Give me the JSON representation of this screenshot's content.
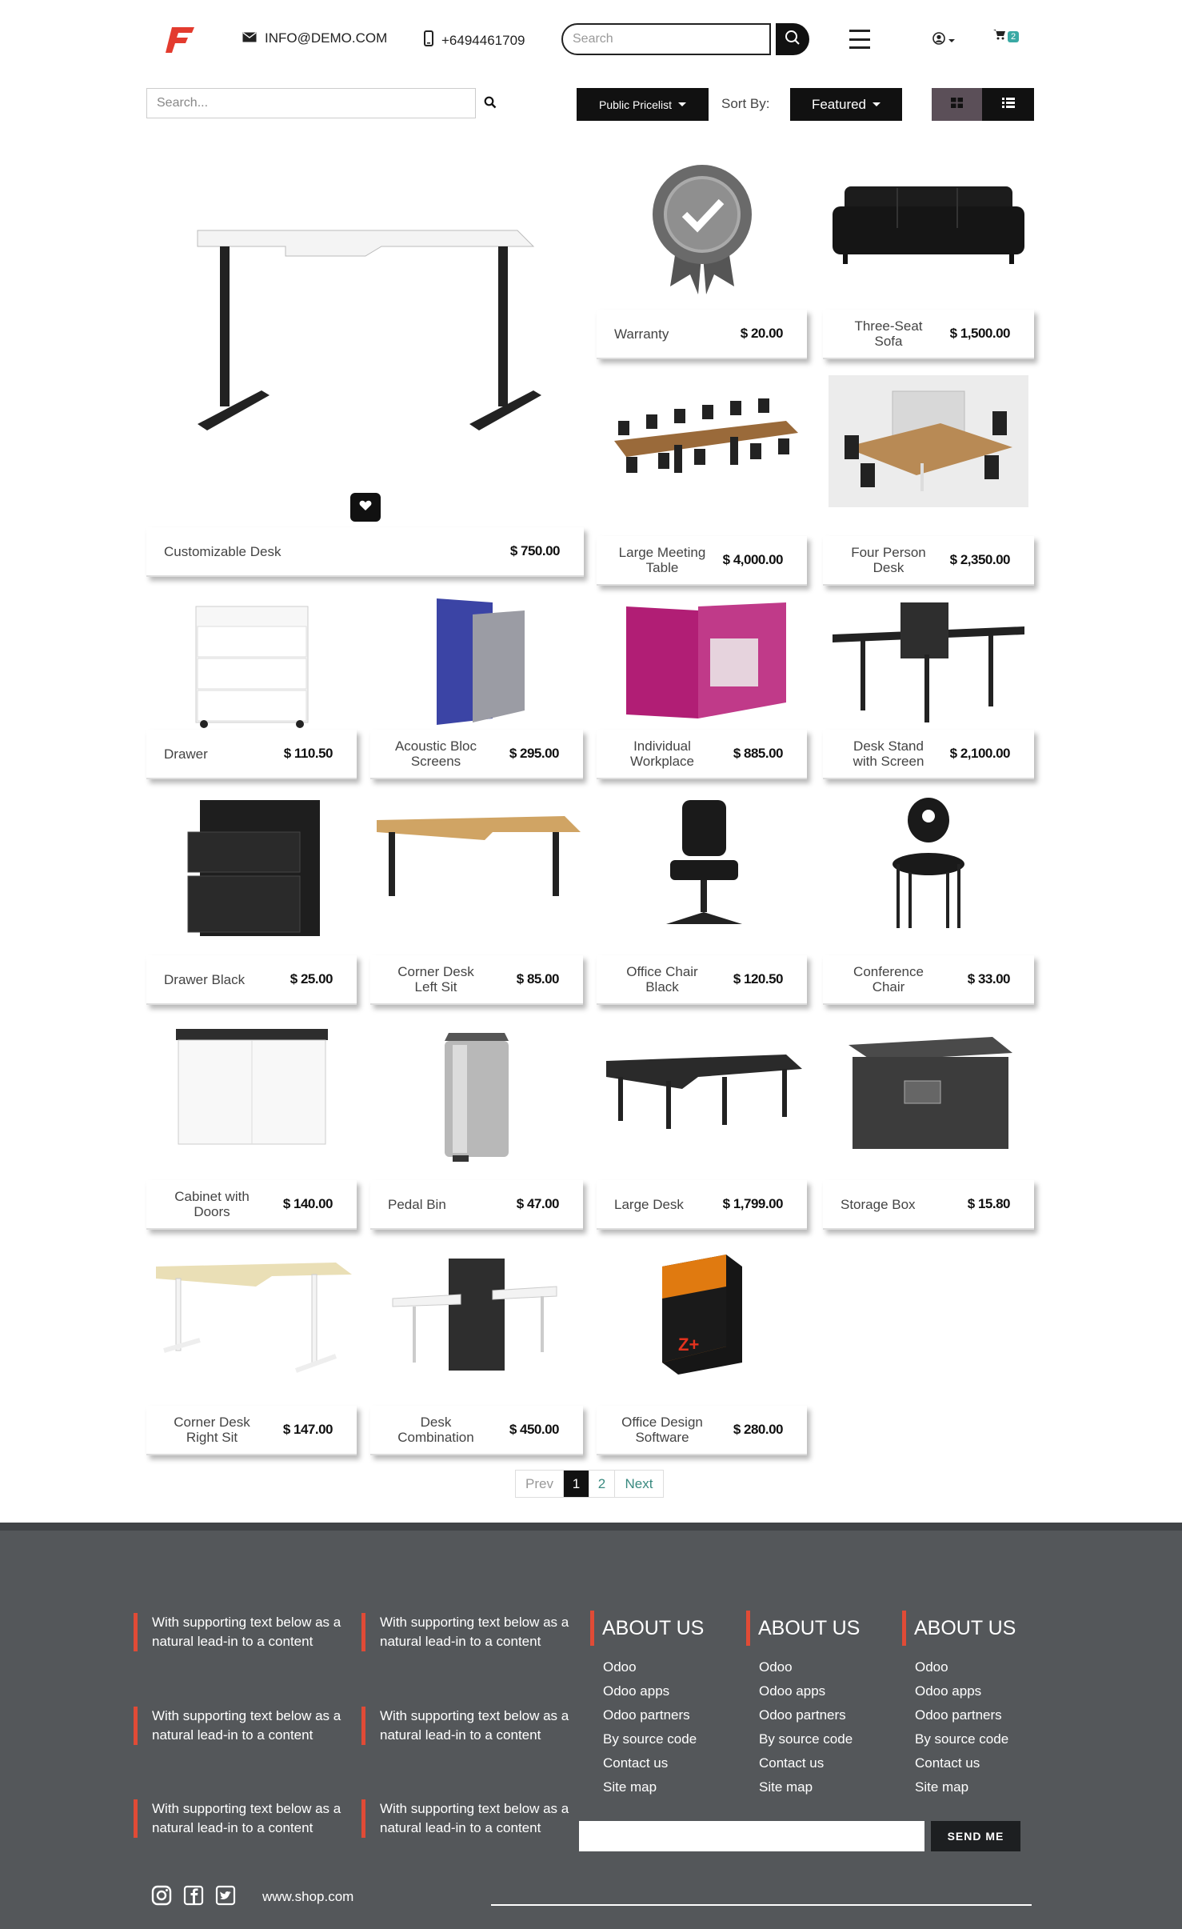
{
  "header": {
    "email": "INFO@DEMO.COM",
    "phone": "+6494461709",
    "search_placeholder": "Search",
    "cart_count": "2"
  },
  "toolbar": {
    "search_placeholder": "Search...",
    "pricelist_label": "Public Pricelist",
    "sort_label": "Sort By:",
    "sort_value": "Featured"
  },
  "products": [
    {
      "name": "Customizable Desk",
      "price": "$ 750.00"
    },
    {
      "name": "Warranty",
      "price": "$ 20.00"
    },
    {
      "name": "Three-Seat Sofa",
      "price": "$ 1,500.00"
    },
    {
      "name": "Large Meeting Table",
      "price": "$ 4,000.00"
    },
    {
      "name": "Four Person Desk",
      "price": "$ 2,350.00"
    },
    {
      "name": "Drawer",
      "price": "$ 110.50"
    },
    {
      "name": "Acoustic Bloc Screens",
      "price": "$ 295.00"
    },
    {
      "name": "Individual Workplace",
      "price": "$ 885.00"
    },
    {
      "name": "Desk Stand with Screen",
      "price": "$ 2,100.00"
    },
    {
      "name": "Drawer Black",
      "price": "$ 25.00"
    },
    {
      "name": "Corner Desk Left Sit",
      "price": "$ 85.00"
    },
    {
      "name": "Office Chair Black",
      "price": "$ 120.50"
    },
    {
      "name": "Conference Chair",
      "price": "$ 33.00"
    },
    {
      "name": "Cabinet with Doors",
      "price": "$ 140.00"
    },
    {
      "name": "Pedal Bin",
      "price": "$ 47.00"
    },
    {
      "name": "Large Desk",
      "price": "$ 1,799.00"
    },
    {
      "name": "Storage Box",
      "price": "$ 15.80"
    },
    {
      "name": "Corner Desk Right Sit",
      "price": "$ 147.00"
    },
    {
      "name": "Desk Combination",
      "price": "$ 450.00"
    },
    {
      "name": "Office Design Software",
      "price": "$ 280.00"
    }
  ],
  "pager": {
    "prev": "Prev",
    "p1": "1",
    "p2": "2",
    "next": "Next"
  },
  "footer": {
    "blurb": "With supporting text below as a natural lead-in to a content",
    "col_title": "ABOUT US",
    "links": [
      "Odoo",
      "Odoo apps",
      "Odoo partners",
      "By source code",
      "Contact us",
      "Site map"
    ],
    "send_label": "SEND ME",
    "website": "www.shop.com"
  },
  "colors": {
    "accent": "#e04b36",
    "footer_bg": "#54575a",
    "teal": "#3aa9a4"
  }
}
